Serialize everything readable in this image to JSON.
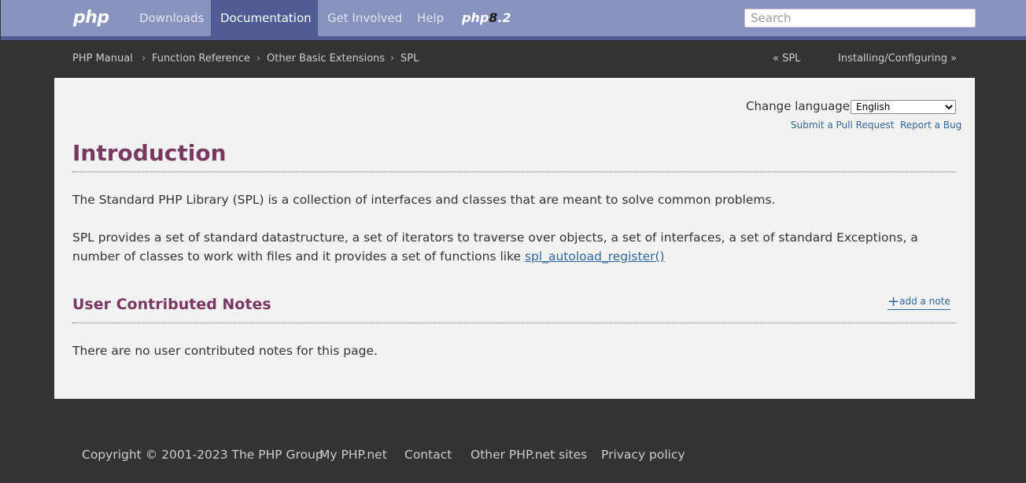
{
  "navbar": {
    "logo": "php",
    "items": [
      {
        "label": "Downloads"
      },
      {
        "label": "Documentation"
      },
      {
        "label": "Get Involved"
      },
      {
        "label": "Help"
      }
    ],
    "badge_text": "php",
    "badge_mark": "8",
    "badge_version": ".2",
    "search_placeholder": "Search"
  },
  "breadcrumb": {
    "items": [
      "PHP Manual",
      "Function Reference",
      "Other Basic Extensions",
      "SPL"
    ],
    "separator": "›",
    "prev": "« SPL",
    "next": "Installing/Configuring »"
  },
  "content": {
    "change_language_label": "Change language:",
    "selected_language": "English",
    "submit_pr": "Submit a Pull Request",
    "report_bug": "Report a Bug",
    "title": "Introduction",
    "para1": "The Standard PHP Library (SPL) is a collection of interfaces and classes that are meant to solve common problems.",
    "para2_text": "SPL provides a set of standard datastructure, a set of iterators to traverse over objects, a set of interfaces, a set of standard Exceptions, a number of classes to work with files and it provides a set of functions like ",
    "para2_link": "spl_autoload_register()",
    "notes_title": "User Contributed Notes",
    "add_note_plus": "+",
    "add_note": "add a note",
    "no_notes": "There are no user contributed notes for this page."
  },
  "footer": {
    "copyright": "Copyright © 2001-2023 The PHP Group",
    "links": [
      "My PHP.net",
      "Contact",
      "Other PHP.net sites",
      "Privacy policy"
    ]
  },
  "colors": {
    "navbar": "#8892bf",
    "navbar_active": "#4f5b93",
    "heading": "#793862",
    "link": "#336699",
    "page_bg": "#333333",
    "card_bg": "#f2f2f2"
  }
}
